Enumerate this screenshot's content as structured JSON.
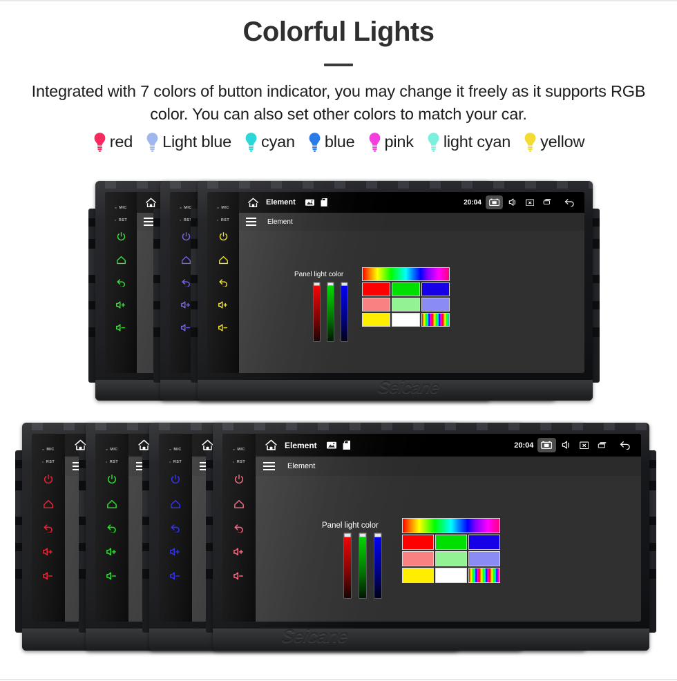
{
  "header": {
    "title": "Colorful Lights",
    "subtitle": "Integrated with 7 colors of button indicator, you may change it freely as it supports RGB color. You can also set other colors to match your car."
  },
  "legend": {
    "items": [
      {
        "label": "red",
        "color": "#f72a5e"
      },
      {
        "label": "Light blue",
        "color": "#9fb6ef"
      },
      {
        "label": "cyan",
        "color": "#2ed7d7"
      },
      {
        "label": "blue",
        "color": "#2a7ae8"
      },
      {
        "label": "pink",
        "color": "#f73ce0"
      },
      {
        "label": "light cyan",
        "color": "#7bf0dd"
      },
      {
        "label": "yellow",
        "color": "#f2dc34"
      }
    ]
  },
  "screen_ui": {
    "statusbar": {
      "home_icon": "home-icon",
      "title": "Element",
      "gallery_icon": "image-icon",
      "bag_icon": "shopping-bag-icon",
      "clock": "20:04",
      "screenshot_icon": "screenshot-icon",
      "mute_icon": "speaker-mute-icon",
      "close_icon": "close-box-icon",
      "recents_icon": "recents-icon",
      "back_icon": "back-arrow-icon"
    },
    "appbar": {
      "menu_icon": "hamburger-menu-icon",
      "title": "Element"
    },
    "panel": {
      "label": "Panel light color",
      "sliders": [
        {
          "name": "red-slider",
          "color": "#ff0000"
        },
        {
          "name": "green-slider",
          "color": "#00e000"
        },
        {
          "name": "blue-slider",
          "color": "#0000ff"
        }
      ],
      "swatches": [
        {
          "name": "hue-spectrum-swatch",
          "type": "hue",
          "color": ""
        },
        {
          "name": "red-swatch",
          "type": "solid",
          "color": "#ff0000"
        },
        {
          "name": "green-swatch",
          "type": "solid",
          "color": "#00e000"
        },
        {
          "name": "blue-swatch",
          "type": "solid",
          "color": "#1800e6"
        },
        {
          "name": "salmon-swatch",
          "type": "solid",
          "color": "#fa8181"
        },
        {
          "name": "light-green-swatch",
          "type": "solid",
          "color": "#92f392"
        },
        {
          "name": "periwinkle-swatch",
          "type": "solid",
          "color": "#8b8bf5"
        },
        {
          "name": "yellow-swatch",
          "type": "solid",
          "color": "#ffee00"
        },
        {
          "name": "white-swatch",
          "type": "solid",
          "color": "#ffffff"
        },
        {
          "name": "rainbow-swatch",
          "type": "rainbow",
          "color": ""
        }
      ]
    }
  },
  "button_panel": {
    "mic_label": "MIC",
    "rst_label": "RST",
    "buttons": [
      {
        "name": "power-button",
        "icon": "power-icon"
      },
      {
        "name": "home-button",
        "icon": "home-outline-icon"
      },
      {
        "name": "back-button",
        "icon": "back-curve-icon"
      },
      {
        "name": "volume-up-button",
        "icon": "volume-up-icon"
      },
      {
        "name": "volume-down-button",
        "icon": "volume-down-icon"
      }
    ]
  },
  "watermark": "Seicane",
  "rows": [
    {
      "name": "top-row",
      "units": [
        {
          "name": "unit-green",
          "button_color": "#2ee02e"
        },
        {
          "name": "unit-violet",
          "button_color": "#6b5ce8"
        },
        {
          "name": "unit-yellow",
          "button_color": "#f2e11a",
          "primary": true
        }
      ]
    },
    {
      "name": "bottom-row",
      "units": [
        {
          "name": "unit-red",
          "button_color": "#ee1122"
        },
        {
          "name": "unit-green-2",
          "button_color": "#17e017"
        },
        {
          "name": "unit-blue",
          "button_color": "#2222ee"
        },
        {
          "name": "unit-light-red",
          "button_color": "#f2607a",
          "primary": true
        }
      ]
    }
  ]
}
